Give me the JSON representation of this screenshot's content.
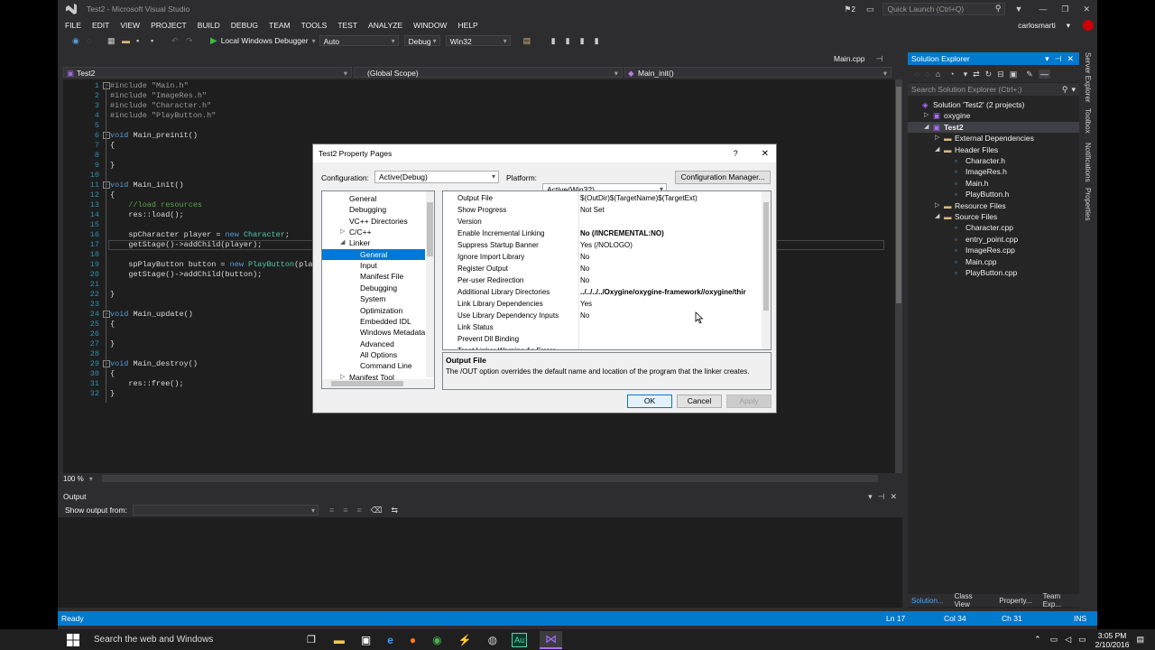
{
  "app": {
    "title": "Test2 - Microsoft Visual Studio",
    "user": "carlosmarti",
    "quick_launch": "Quick Launch (Ctrl+Q)",
    "notifications": "2"
  },
  "menu": [
    "FILE",
    "EDIT",
    "VIEW",
    "PROJECT",
    "BUILD",
    "DEBUG",
    "TEAM",
    "TOOLS",
    "TEST",
    "ANALYZE",
    "WINDOW",
    "HELP"
  ],
  "toolbar": {
    "debugger": "Local Windows Debugger",
    "config_auto": "Auto",
    "config": "Debug",
    "platform": "Win32"
  },
  "tabs": {
    "active": "Main.cpp"
  },
  "nav": {
    "project": "Test2",
    "scope": "(Global Scope)",
    "member": "Main_init()"
  },
  "code": [
    {
      "n": "1",
      "t": "#include \"Main.h\"",
      "k": "pp"
    },
    {
      "n": "2",
      "t": "#include \"ImageRes.h\"",
      "k": "pp"
    },
    {
      "n": "3",
      "t": "#include \"Character.h\"",
      "k": "pp"
    },
    {
      "n": "4",
      "t": "#include \"PlayButton.h\"",
      "k": "pp"
    },
    {
      "n": "5",
      "t": "",
      "k": ""
    },
    {
      "n": "6",
      "t": "void Main_preinit()",
      "k": "fn"
    },
    {
      "n": "7",
      "t": "{",
      "k": ""
    },
    {
      "n": "8",
      "t": "",
      "k": ""
    },
    {
      "n": "9",
      "t": "}",
      "k": ""
    },
    {
      "n": "10",
      "t": "",
      "k": ""
    },
    {
      "n": "11",
      "t": "void Main_init()",
      "k": "fn"
    },
    {
      "n": "12",
      "t": "{",
      "k": ""
    },
    {
      "n": "13",
      "t": "    //load resources",
      "k": "cm"
    },
    {
      "n": "14",
      "t": "    res::load();",
      "k": ""
    },
    {
      "n": "15",
      "t": "",
      "k": ""
    },
    {
      "n": "16",
      "t": "    spCharacter player = new Character;",
      "k": "new"
    },
    {
      "n": "17",
      "t": "    getStage()->addChild(player);",
      "k": ""
    },
    {
      "n": "18",
      "t": "",
      "k": ""
    },
    {
      "n": "19",
      "t": "    spPlayButton button = new PlayButton(player",
      "k": "new"
    },
    {
      "n": "20",
      "t": "    getStage()->addChild(button);",
      "k": ""
    },
    {
      "n": "21",
      "t": "",
      "k": ""
    },
    {
      "n": "22",
      "t": "}",
      "k": ""
    },
    {
      "n": "23",
      "t": "",
      "k": ""
    },
    {
      "n": "24",
      "t": "void Main_update()",
      "k": "fn"
    },
    {
      "n": "25",
      "t": "{",
      "k": ""
    },
    {
      "n": "26",
      "t": "",
      "k": ""
    },
    {
      "n": "27",
      "t": "}",
      "k": ""
    },
    {
      "n": "28",
      "t": "",
      "k": ""
    },
    {
      "n": "29",
      "t": "void Main_destroy()",
      "k": "fn"
    },
    {
      "n": "30",
      "t": "{",
      "k": ""
    },
    {
      "n": "31",
      "t": "    res::free();",
      "k": ""
    },
    {
      "n": "32",
      "t": "}",
      "k": ""
    }
  ],
  "zoom": "100 %",
  "output": {
    "title": "Output",
    "show_from": "Show output from:"
  },
  "solution_explorer": {
    "title": "Solution Explorer",
    "search_placeholder": "Search Solution Explorer (Ctrl+;)",
    "items": [
      {
        "label": "Solution 'Test2' (2 projects)",
        "depth": 0,
        "exp": ""
      },
      {
        "label": "oxygine",
        "depth": 1,
        "exp": "▷"
      },
      {
        "label": "Test2",
        "depth": 1,
        "exp": "◢",
        "sel": true
      },
      {
        "label": "External Dependencies",
        "depth": 2,
        "exp": "▷"
      },
      {
        "label": "Header Files",
        "depth": 2,
        "exp": "◢"
      },
      {
        "label": "Character.h",
        "depth": 3,
        "exp": ""
      },
      {
        "label": "ImageRes.h",
        "depth": 3,
        "exp": ""
      },
      {
        "label": "Main.h",
        "depth": 3,
        "exp": ""
      },
      {
        "label": "PlayButton.h",
        "depth": 3,
        "exp": ""
      },
      {
        "label": "Resource Files",
        "depth": 2,
        "exp": "▷"
      },
      {
        "label": "Source Files",
        "depth": 2,
        "exp": "◢"
      },
      {
        "label": "Character.cpp",
        "depth": 3,
        "exp": ""
      },
      {
        "label": "entry_point.cpp",
        "depth": 3,
        "exp": ""
      },
      {
        "label": "ImageRes.cpp",
        "depth": 3,
        "exp": ""
      },
      {
        "label": "Main.cpp",
        "depth": 3,
        "exp": ""
      },
      {
        "label": "PlayButton.cpp",
        "depth": 3,
        "exp": ""
      }
    ],
    "bottom_tabs": [
      "Solution...",
      "Class View",
      "Property...",
      "Team Exp..."
    ]
  },
  "side_tabs": [
    "Server Explorer",
    "Toolbox",
    "Notifications",
    "Properties"
  ],
  "status": {
    "ready": "Ready",
    "ln": "Ln 17",
    "col": "Col 34",
    "ch": "Ch 31",
    "ins": "INS"
  },
  "dialog": {
    "title": "Test2 Property Pages",
    "help": "?",
    "config_label": "Configuration:",
    "config_value": "Active(Debug)",
    "platform_label": "Platform:",
    "platform_value": "Active(Win32)",
    "config_manager": "Configuration Manager...",
    "tree": [
      {
        "label": "General",
        "depth": 1,
        "exp": ""
      },
      {
        "label": "Debugging",
        "depth": 1,
        "exp": ""
      },
      {
        "label": "VC++ Directories",
        "depth": 1,
        "exp": ""
      },
      {
        "label": "C/C++",
        "depth": 1,
        "exp": "▷"
      },
      {
        "label": "Linker",
        "depth": 1,
        "exp": "◢"
      },
      {
        "label": "General",
        "depth": 2,
        "exp": "",
        "sel": true
      },
      {
        "label": "Input",
        "depth": 2,
        "exp": ""
      },
      {
        "label": "Manifest File",
        "depth": 2,
        "exp": ""
      },
      {
        "label": "Debugging",
        "depth": 2,
        "exp": ""
      },
      {
        "label": "System",
        "depth": 2,
        "exp": ""
      },
      {
        "label": "Optimization",
        "depth": 2,
        "exp": ""
      },
      {
        "label": "Embedded IDL",
        "depth": 2,
        "exp": ""
      },
      {
        "label": "Windows Metadata",
        "depth": 2,
        "exp": ""
      },
      {
        "label": "Advanced",
        "depth": 2,
        "exp": ""
      },
      {
        "label": "All Options",
        "depth": 2,
        "exp": ""
      },
      {
        "label": "Command Line",
        "depth": 2,
        "exp": ""
      },
      {
        "label": "Manifest Tool",
        "depth": 1,
        "exp": "▷"
      }
    ],
    "props": [
      {
        "name": "Output File",
        "value": "$(OutDir)$(TargetName)$(TargetExt)",
        "bold": false
      },
      {
        "name": "Show Progress",
        "value": "Not Set",
        "bold": false
      },
      {
        "name": "Version",
        "value": "",
        "bold": false
      },
      {
        "name": "Enable Incremental Linking",
        "value": "No (/INCREMENTAL:NO)",
        "bold": true
      },
      {
        "name": "Suppress Startup Banner",
        "value": "Yes (/NOLOGO)",
        "bold": false
      },
      {
        "name": "Ignore Import Library",
        "value": "No",
        "bold": false
      },
      {
        "name": "Register Output",
        "value": "No",
        "bold": false
      },
      {
        "name": "Per-user Redirection",
        "value": "No",
        "bold": false
      },
      {
        "name": "Additional Library Directories",
        "value": "../../../../Oxygine/oxygine-framework//oxygine/thir",
        "bold": true
      },
      {
        "name": "Link Library Dependencies",
        "value": "Yes",
        "bold": false
      },
      {
        "name": "Use Library Dependency Inputs",
        "value": "No",
        "bold": false
      },
      {
        "name": "Link Status",
        "value": "",
        "bold": false
      },
      {
        "name": "Prevent Dll Binding",
        "value": "",
        "bold": false
      },
      {
        "name": "Treat Linker Warning As Errors",
        "value": "",
        "bold": false
      }
    ],
    "desc_title": "Output File",
    "desc_text": "The /OUT option overrides the default name and location of the program that the linker creates.",
    "ok": "OK",
    "cancel": "Cancel",
    "apply": "Apply"
  },
  "taskbar": {
    "search": "Search the web and Windows",
    "time": "3:05 PM",
    "date": "2/10/2016"
  }
}
